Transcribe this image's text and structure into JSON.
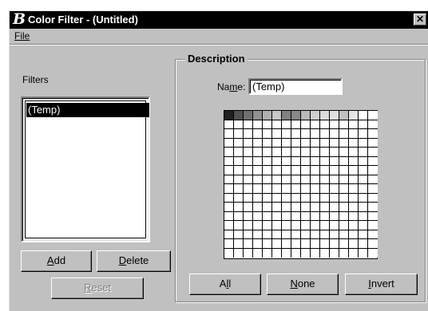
{
  "window": {
    "title": "Color Filter - (Untitled)",
    "close_glyph": "✕"
  },
  "menu": {
    "file": "File"
  },
  "left": {
    "filters_label": "Filters",
    "list_items": [
      "(Temp)"
    ],
    "add_label": "Add",
    "delete_label": "Delete",
    "reset_label": "Reset"
  },
  "description": {
    "group_title": "Description",
    "name_label": "Name:",
    "name_value": "(Temp)",
    "all_label": "All",
    "none_label": "None",
    "invert_label": "Invert"
  },
  "color_grid": {
    "columns": 16,
    "rows": 16,
    "first_row_colors": [
      "#202020",
      "#505050",
      "#707070",
      "#909090",
      "#b0b0b0",
      "#c8c8c8",
      "#808080",
      "#888888",
      "#b8b8b8",
      "#d0d0d0",
      "#dcdcdc",
      "#e0e0e0",
      "#c0c0c0",
      "#e4e4e4",
      "#ffffff",
      "#ffffff"
    ],
    "default_color": "#ffffff"
  },
  "colors": {
    "face": "#c0c0c0",
    "titlebar": "#000000",
    "selection": "#000000"
  }
}
